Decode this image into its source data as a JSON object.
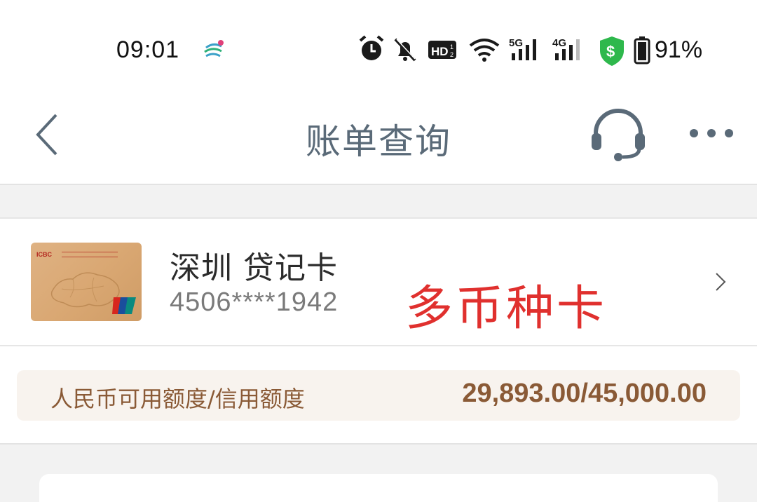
{
  "status_bar": {
    "time": "09:01",
    "battery_percent": "91%",
    "network_labels": [
      "HD",
      "5G",
      "4G"
    ],
    "icons": [
      "carrier-icon",
      "alarm-icon",
      "mute-icon",
      "hd-icon",
      "wifi-icon",
      "signal-5g-icon",
      "signal-4g-icon",
      "security-shield-icon",
      "battery-icon"
    ]
  },
  "nav": {
    "title": "账单查询",
    "back_icon": "back-arrow-icon",
    "service_icon": "headset-icon",
    "more_icon": "more-dots-icon"
  },
  "card": {
    "name": "深圳 贷记卡",
    "number": "4506****1942",
    "annotation": "多币种卡",
    "thumb_bank_code": "ICBC",
    "chevron_icon": "chevron-right-icon"
  },
  "credit": {
    "label": "人民币可用额度/信用额度",
    "value": "29,893.00/45,000.00"
  },
  "colors": {
    "title": "#5a6a78",
    "annotation": "#e0302e",
    "credit_text": "#8a5a36",
    "credit_bg": "#f8f3ee",
    "shield": "#2eb84c"
  }
}
